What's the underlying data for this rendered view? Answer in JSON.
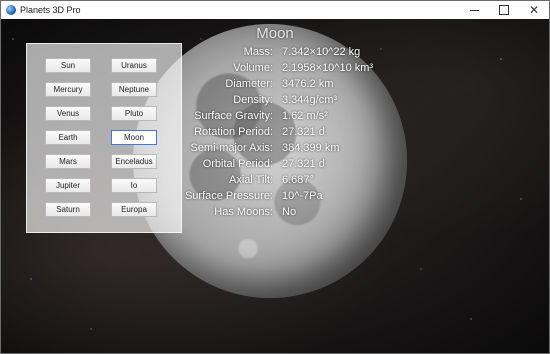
{
  "window": {
    "title": "Planets 3D Pro",
    "controls": {
      "minimize_icon": "minimize-icon",
      "maximize_icon": "maximize-icon",
      "close_icon": "close-icon",
      "close_glyph": "✕"
    }
  },
  "colors": {
    "selected_border": "#3d7bd6",
    "panel_bg": "rgba(255,255,255,0.65)",
    "text": "#ffffff"
  },
  "planet_buttons": [
    {
      "label": "Sun",
      "selected": false
    },
    {
      "label": "Uranus",
      "selected": false
    },
    {
      "label": "Mercury",
      "selected": false
    },
    {
      "label": "Neptune",
      "selected": false
    },
    {
      "label": "Venus",
      "selected": false
    },
    {
      "label": "Pluto",
      "selected": false
    },
    {
      "label": "Earth",
      "selected": false
    },
    {
      "label": "Moon",
      "selected": true
    },
    {
      "label": "Mars",
      "selected": false
    },
    {
      "label": "Enceladus",
      "selected": false
    },
    {
      "label": "Jupiter",
      "selected": false
    },
    {
      "label": "Io",
      "selected": false
    },
    {
      "label": "Saturn",
      "selected": false
    },
    {
      "label": "Europa",
      "selected": false
    }
  ],
  "info": {
    "title": "Moon",
    "rows": [
      {
        "label": "Mass:",
        "value": "7.342×10^22 kg"
      },
      {
        "label": "Volume:",
        "value": "2.1958×10^10 km³"
      },
      {
        "label": "Diameter:",
        "value": "3476.2 km"
      },
      {
        "label": "Density:",
        "value": "3.344g/cm³"
      },
      {
        "label": "Surface Gravity:",
        "value": "1.62 m/s²"
      },
      {
        "label": "Rotation Period:",
        "value": "27.321 d"
      },
      {
        "label": "Semi-major Axis:",
        "value": "384,399 km"
      },
      {
        "label": "Orbital Period:",
        "value": "27.321 d"
      },
      {
        "label": "Axial Tilt:",
        "value": "6.687°"
      },
      {
        "label": "Surface Pressure:",
        "value": "10^-7Pa"
      },
      {
        "label": "Has Moons:",
        "value": "No"
      }
    ]
  }
}
